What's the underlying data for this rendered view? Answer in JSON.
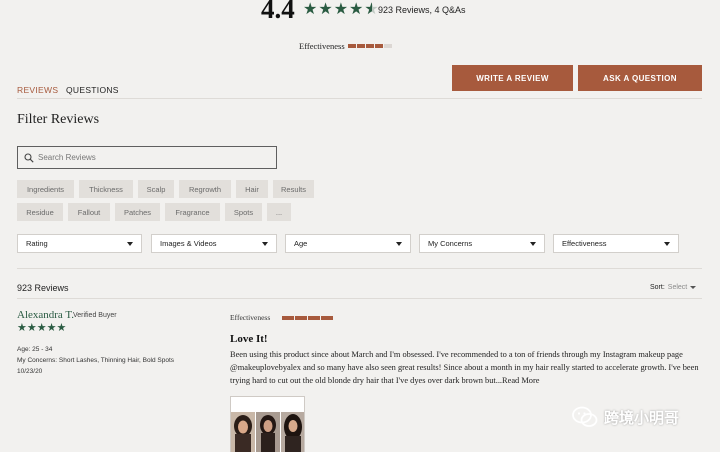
{
  "summary": {
    "rating": "4.4",
    "stars": 4.5,
    "counts_text": "923 Reviews, 4 Q&As",
    "effectiveness_label": "Effectiveness",
    "effectiveness_level": 0.8
  },
  "actions": {
    "write_review": "WRITE A REVIEW",
    "ask_question": "ASK A QUESTION"
  },
  "tabs": [
    {
      "label": "REVIEWS",
      "active": true
    },
    {
      "label": "QUESTIONS",
      "active": false
    }
  ],
  "filter": {
    "title": "Filter Reviews",
    "search_placeholder": "Search Reviews",
    "chips_row1": [
      "Ingredients",
      "Thickness",
      "Scalp",
      "Regrowth",
      "Hair",
      "Results"
    ],
    "chips_row2": [
      "Residue",
      "Fallout",
      "Patches",
      "Fragrance",
      "Spots",
      "..."
    ],
    "dropdowns": [
      "Rating",
      "Images & Videos",
      "Age",
      "My Concerns",
      "Effectiveness"
    ]
  },
  "list": {
    "count_text": "923 Reviews",
    "sort_label": "Sort:",
    "sort_value": "Select"
  },
  "review": {
    "author": "Alexandra T.",
    "badge": "Verified Buyer",
    "stars": 5,
    "age": "Age:  25 - 34",
    "concerns": "My Concerns:  Short Lashes, Thinning Hair, Bold Spots",
    "date": "10/23/20",
    "effectiveness_label": "Effectiveness",
    "effectiveness_level": 1.0,
    "title": "Love It!",
    "body": "Been using this product since about March and I'm obsessed. I've recommended to a ton of friends through my Instagram makeup page @makeuplovebyalex and so many have also seen great results! Since about a month in my hair really started to accelerate growth. I've been trying hard to cut out the old blonde dry hair that I've dyes over dark brown but...",
    "read_more": "Read More"
  },
  "watermark": {
    "text": "跨境小明哥",
    "icon": "wechat-icon"
  },
  "colors": {
    "accent": "#a75a3d",
    "star": "#2a5b42",
    "background": "#f2f1ef"
  }
}
